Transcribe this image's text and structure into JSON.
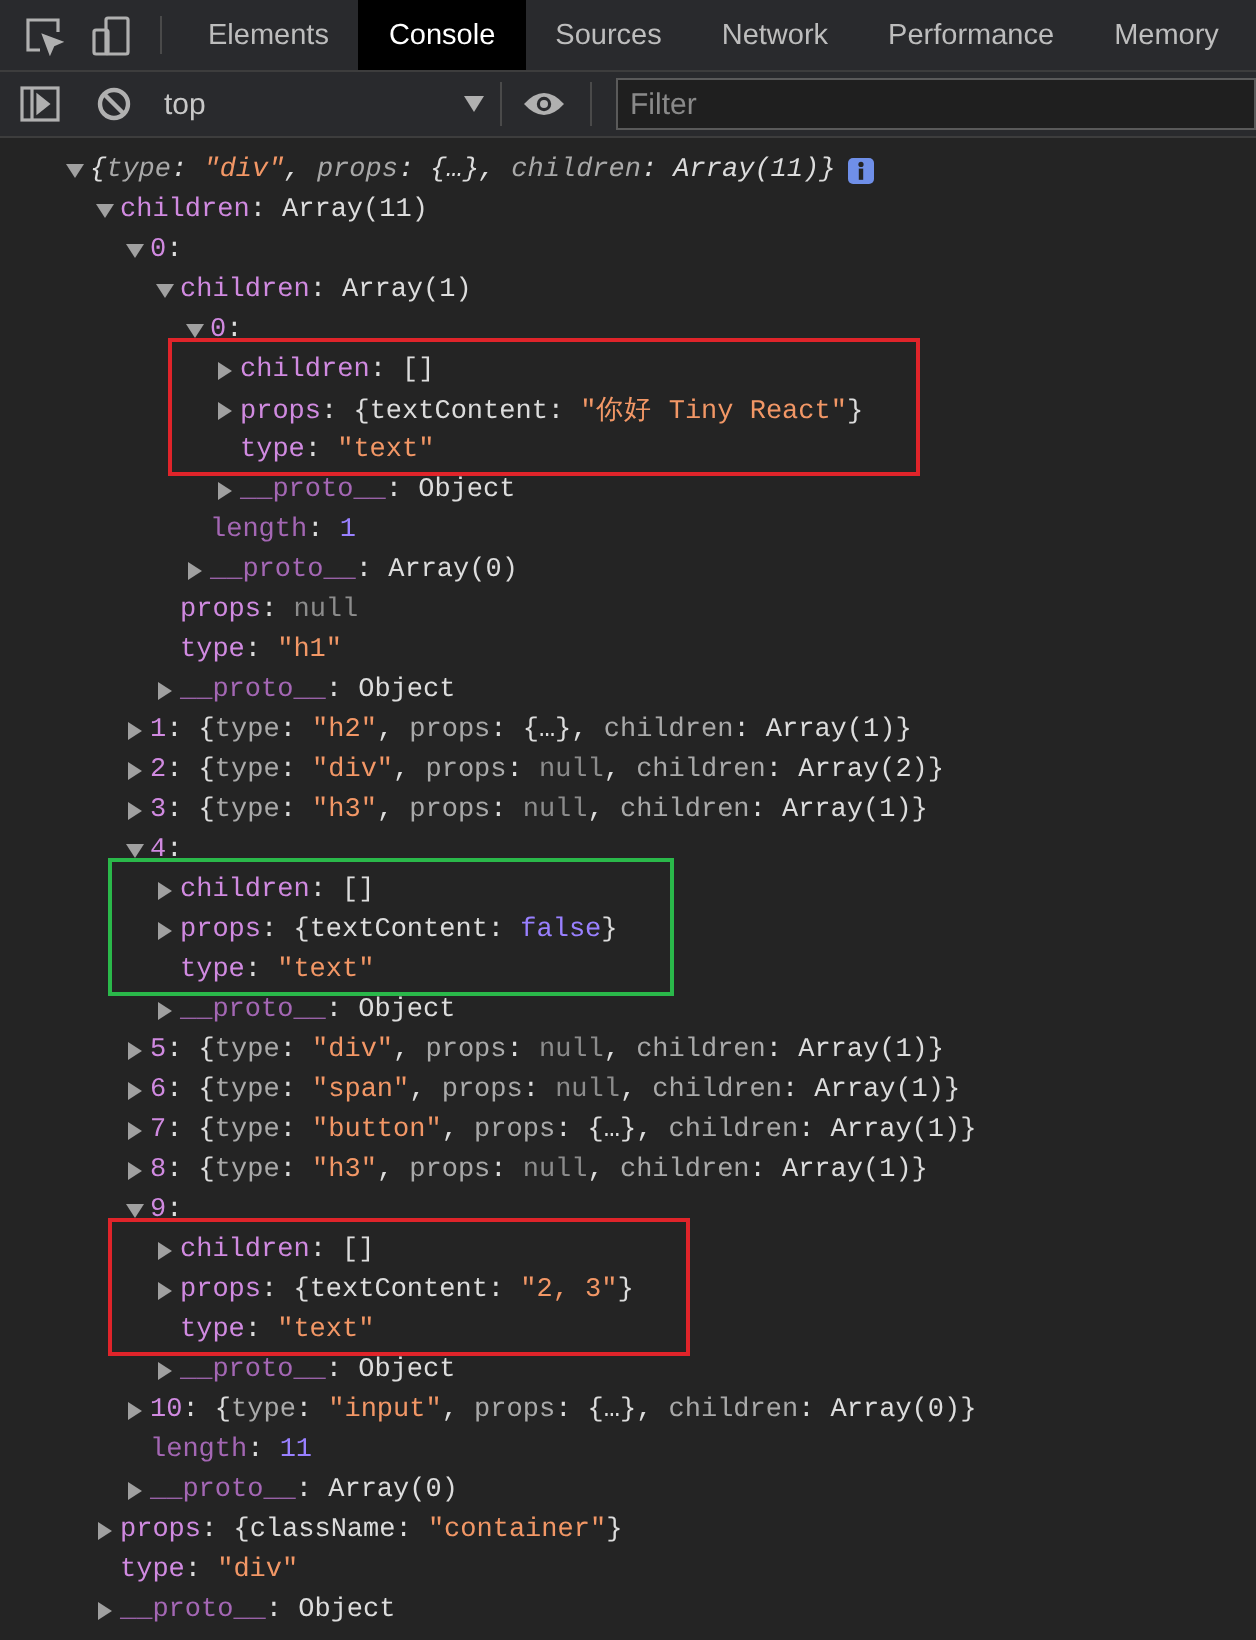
{
  "toolbar": {
    "tabs": [
      {
        "label": "Elements",
        "selected": false
      },
      {
        "label": "Console",
        "selected": true
      },
      {
        "label": "Sources",
        "selected": false
      },
      {
        "label": "Network",
        "selected": false
      },
      {
        "label": "Performance",
        "selected": false
      },
      {
        "label": "Memory",
        "selected": false
      }
    ],
    "context": {
      "value": "top"
    },
    "filter": {
      "placeholder": "Filter"
    }
  },
  "tree": [
    {
      "kind": "line",
      "italic": true,
      "badge": true,
      "expanded": true,
      "segments": [
        {
          "kind": "plain",
          "text": "{"
        },
        {
          "kind": "pkey",
          "text": "type"
        },
        {
          "kind": "plain",
          "text": ": "
        },
        {
          "kind": "str",
          "text": "\"div\""
        },
        {
          "kind": "plain",
          "text": ", "
        },
        {
          "kind": "pkey",
          "text": "props"
        },
        {
          "kind": "plain",
          "text": ": {…}, "
        },
        {
          "kind": "pkey",
          "text": "children"
        },
        {
          "kind": "plain",
          "text": ": Array(11)}"
        }
      ],
      "children": [
        {
          "kind": "line",
          "expanded": true,
          "segments": [
            {
              "kind": "key",
              "text": "children"
            },
            {
              "kind": "plain",
              "text": ": Array(11)"
            }
          ],
          "children": [
            {
              "kind": "line",
              "expanded": true,
              "segments": [
                {
                  "kind": "key",
                  "text": "0"
                },
                {
                  "kind": "plain",
                  "text": ":"
                }
              ],
              "children": [
                {
                  "kind": "line",
                  "expanded": true,
                  "segments": [
                    {
                      "kind": "key",
                      "text": "children"
                    },
                    {
                      "kind": "plain",
                      "text": ": Array(1)"
                    }
                  ],
                  "children": [
                    {
                      "kind": "line",
                      "expanded": true,
                      "segments": [
                        {
                          "kind": "key",
                          "text": "0"
                        },
                        {
                          "kind": "plain",
                          "text": ":"
                        }
                      ],
                      "children": [
                        {
                          "kind": "highlight",
                          "color": "#e0242a",
                          "children": [
                            {
                              "kind": "line",
                              "expanded": false,
                              "segments": [
                                {
                                  "kind": "key",
                                  "text": "children"
                                },
                                {
                                  "kind": "plain",
                                  "text": ": []"
                                }
                              ]
                            },
                            {
                              "kind": "line",
                              "expanded": false,
                              "segments": [
                                {
                                  "kind": "key",
                                  "text": "props"
                                },
                                {
                                  "kind": "plain",
                                  "text": ": {textContent: "
                                },
                                {
                                  "kind": "str",
                                  "text": "\"你好 Tiny React\""
                                },
                                {
                                  "kind": "plain",
                                  "text": "}"
                                }
                              ]
                            },
                            {
                              "kind": "line",
                              "segments": [
                                {
                                  "kind": "key",
                                  "text": "type"
                                },
                                {
                                  "kind": "plain",
                                  "text": ": "
                                },
                                {
                                  "kind": "str",
                                  "text": "\"text\""
                                }
                              ]
                            }
                          ]
                        },
                        {
                          "kind": "line",
                          "expanded": false,
                          "segments": [
                            {
                              "kind": "meta",
                              "text": "__proto__"
                            },
                            {
                              "kind": "plain",
                              "text": ": Object"
                            }
                          ]
                        }
                      ]
                    },
                    {
                      "kind": "line",
                      "segments": [
                        {
                          "kind": "meta",
                          "text": "length"
                        },
                        {
                          "kind": "plain",
                          "text": ": "
                        },
                        {
                          "kind": "num",
                          "text": "1"
                        }
                      ]
                    },
                    {
                      "kind": "line",
                      "expanded": false,
                      "segments": [
                        {
                          "kind": "meta",
                          "text": "__proto__"
                        },
                        {
                          "kind": "plain",
                          "text": ": Array(0)"
                        }
                      ]
                    }
                  ]
                },
                {
                  "kind": "line",
                  "segments": [
                    {
                      "kind": "key",
                      "text": "props"
                    },
                    {
                      "kind": "plain",
                      "text": ": "
                    },
                    {
                      "kind": "null",
                      "text": "null"
                    }
                  ]
                },
                {
                  "kind": "line",
                  "segments": [
                    {
                      "kind": "key",
                      "text": "type"
                    },
                    {
                      "kind": "plain",
                      "text": ": "
                    },
                    {
                      "kind": "str",
                      "text": "\"h1\""
                    }
                  ]
                },
                {
                  "kind": "line",
                  "expanded": false,
                  "segments": [
                    {
                      "kind": "meta",
                      "text": "__proto__"
                    },
                    {
                      "kind": "plain",
                      "text": ": Object"
                    }
                  ]
                }
              ]
            },
            {
              "kind": "line",
              "expanded": false,
              "segments": [
                {
                  "kind": "key",
                  "text": "1"
                },
                {
                  "kind": "plain",
                  "text": ": {"
                },
                {
                  "kind": "pkey",
                  "text": "type"
                },
                {
                  "kind": "plain",
                  "text": ": "
                },
                {
                  "kind": "str",
                  "text": "\"h2\""
                },
                {
                  "kind": "plain",
                  "text": ", "
                },
                {
                  "kind": "pkey",
                  "text": "props"
                },
                {
                  "kind": "plain",
                  "text": ": {…}, "
                },
                {
                  "kind": "pkey",
                  "text": "children"
                },
                {
                  "kind": "plain",
                  "text": ": Array(1)}"
                }
              ]
            },
            {
              "kind": "line",
              "expanded": false,
              "segments": [
                {
                  "kind": "key",
                  "text": "2"
                },
                {
                  "kind": "plain",
                  "text": ": {"
                },
                {
                  "kind": "pkey",
                  "text": "type"
                },
                {
                  "kind": "plain",
                  "text": ": "
                },
                {
                  "kind": "str",
                  "text": "\"div\""
                },
                {
                  "kind": "plain",
                  "text": ", "
                },
                {
                  "kind": "pkey",
                  "text": "props"
                },
                {
                  "kind": "plain",
                  "text": ": "
                },
                {
                  "kind": "null",
                  "text": "null"
                },
                {
                  "kind": "plain",
                  "text": ", "
                },
                {
                  "kind": "pkey",
                  "text": "children"
                },
                {
                  "kind": "plain",
                  "text": ": Array(2)}"
                }
              ]
            },
            {
              "kind": "line",
              "expanded": false,
              "segments": [
                {
                  "kind": "key",
                  "text": "3"
                },
                {
                  "kind": "plain",
                  "text": ": {"
                },
                {
                  "kind": "pkey",
                  "text": "type"
                },
                {
                  "kind": "plain",
                  "text": ": "
                },
                {
                  "kind": "str",
                  "text": "\"h3\""
                },
                {
                  "kind": "plain",
                  "text": ", "
                },
                {
                  "kind": "pkey",
                  "text": "props"
                },
                {
                  "kind": "plain",
                  "text": ": "
                },
                {
                  "kind": "null",
                  "text": "null"
                },
                {
                  "kind": "plain",
                  "text": ", "
                },
                {
                  "kind": "pkey",
                  "text": "children"
                },
                {
                  "kind": "plain",
                  "text": ": Array(1)}"
                }
              ]
            },
            {
              "kind": "line",
              "expanded": true,
              "segments": [
                {
                  "kind": "key",
                  "text": "4"
                },
                {
                  "kind": "plain",
                  "text": ":"
                }
              ],
              "children": [
                {
                  "kind": "highlight",
                  "color": "#2ab84a",
                  "children": [
                    {
                      "kind": "line",
                      "expanded": false,
                      "segments": [
                        {
                          "kind": "key",
                          "text": "children"
                        },
                        {
                          "kind": "plain",
                          "text": ": []"
                        }
                      ]
                    },
                    {
                      "kind": "line",
                      "expanded": false,
                      "segments": [
                        {
                          "kind": "key",
                          "text": "props"
                        },
                        {
                          "kind": "plain",
                          "text": ": {textContent: "
                        },
                        {
                          "kind": "num",
                          "text": "false"
                        },
                        {
                          "kind": "plain",
                          "text": "}"
                        }
                      ]
                    },
                    {
                      "kind": "line",
                      "segments": [
                        {
                          "kind": "key",
                          "text": "type"
                        },
                        {
                          "kind": "plain",
                          "text": ": "
                        },
                        {
                          "kind": "str",
                          "text": "\"text\""
                        }
                      ]
                    }
                  ]
                },
                {
                  "kind": "line",
                  "expanded": false,
                  "segments": [
                    {
                      "kind": "meta",
                      "text": "__proto__"
                    },
                    {
                      "kind": "plain",
                      "text": ": Object"
                    }
                  ]
                }
              ]
            },
            {
              "kind": "line",
              "expanded": false,
              "segments": [
                {
                  "kind": "key",
                  "text": "5"
                },
                {
                  "kind": "plain",
                  "text": ": {"
                },
                {
                  "kind": "pkey",
                  "text": "type"
                },
                {
                  "kind": "plain",
                  "text": ": "
                },
                {
                  "kind": "str",
                  "text": "\"div\""
                },
                {
                  "kind": "plain",
                  "text": ", "
                },
                {
                  "kind": "pkey",
                  "text": "props"
                },
                {
                  "kind": "plain",
                  "text": ": "
                },
                {
                  "kind": "null",
                  "text": "null"
                },
                {
                  "kind": "plain",
                  "text": ", "
                },
                {
                  "kind": "pkey",
                  "text": "children"
                },
                {
                  "kind": "plain",
                  "text": ": Array(1)}"
                }
              ]
            },
            {
              "kind": "line",
              "expanded": false,
              "segments": [
                {
                  "kind": "key",
                  "text": "6"
                },
                {
                  "kind": "plain",
                  "text": ": {"
                },
                {
                  "kind": "pkey",
                  "text": "type"
                },
                {
                  "kind": "plain",
                  "text": ": "
                },
                {
                  "kind": "str",
                  "text": "\"span\""
                },
                {
                  "kind": "plain",
                  "text": ", "
                },
                {
                  "kind": "pkey",
                  "text": "props"
                },
                {
                  "kind": "plain",
                  "text": ": "
                },
                {
                  "kind": "null",
                  "text": "null"
                },
                {
                  "kind": "plain",
                  "text": ", "
                },
                {
                  "kind": "pkey",
                  "text": "children"
                },
                {
                  "kind": "plain",
                  "text": ": Array(1)}"
                }
              ]
            },
            {
              "kind": "line",
              "expanded": false,
              "segments": [
                {
                  "kind": "key",
                  "text": "7"
                },
                {
                  "kind": "plain",
                  "text": ": {"
                },
                {
                  "kind": "pkey",
                  "text": "type"
                },
                {
                  "kind": "plain",
                  "text": ": "
                },
                {
                  "kind": "str",
                  "text": "\"button\""
                },
                {
                  "kind": "plain",
                  "text": ", "
                },
                {
                  "kind": "pkey",
                  "text": "props"
                },
                {
                  "kind": "plain",
                  "text": ": {…}, "
                },
                {
                  "kind": "pkey",
                  "text": "children"
                },
                {
                  "kind": "plain",
                  "text": ": Array(1)}"
                }
              ]
            },
            {
              "kind": "line",
              "expanded": false,
              "segments": [
                {
                  "kind": "key",
                  "text": "8"
                },
                {
                  "kind": "plain",
                  "text": ": {"
                },
                {
                  "kind": "pkey",
                  "text": "type"
                },
                {
                  "kind": "plain",
                  "text": ": "
                },
                {
                  "kind": "str",
                  "text": "\"h3\""
                },
                {
                  "kind": "plain",
                  "text": ", "
                },
                {
                  "kind": "pkey",
                  "text": "props"
                },
                {
                  "kind": "plain",
                  "text": ": "
                },
                {
                  "kind": "null",
                  "text": "null"
                },
                {
                  "kind": "plain",
                  "text": ", "
                },
                {
                  "kind": "pkey",
                  "text": "children"
                },
                {
                  "kind": "plain",
                  "text": ": Array(1)}"
                }
              ]
            },
            {
              "kind": "line",
              "expanded": true,
              "segments": [
                {
                  "kind": "key",
                  "text": "9"
                },
                {
                  "kind": "plain",
                  "text": ":"
                }
              ],
              "children": [
                {
                  "kind": "highlight",
                  "color": "#e0242a",
                  "children": [
                    {
                      "kind": "line",
                      "expanded": false,
                      "segments": [
                        {
                          "kind": "key",
                          "text": "children"
                        },
                        {
                          "kind": "plain",
                          "text": ": []"
                        }
                      ]
                    },
                    {
                      "kind": "line",
                      "expanded": false,
                      "segments": [
                        {
                          "kind": "key",
                          "text": "props"
                        },
                        {
                          "kind": "plain",
                          "text": ": {textContent: "
                        },
                        {
                          "kind": "str",
                          "text": "\"2, 3\""
                        },
                        {
                          "kind": "plain",
                          "text": "}"
                        }
                      ]
                    },
                    {
                      "kind": "line",
                      "segments": [
                        {
                          "kind": "key",
                          "text": "type"
                        },
                        {
                          "kind": "plain",
                          "text": ": "
                        },
                        {
                          "kind": "str",
                          "text": "\"text\""
                        }
                      ]
                    }
                  ]
                },
                {
                  "kind": "line",
                  "expanded": false,
                  "segments": [
                    {
                      "kind": "meta",
                      "text": "__proto__"
                    },
                    {
                      "kind": "plain",
                      "text": ": Object"
                    }
                  ]
                }
              ]
            },
            {
              "kind": "line",
              "expanded": false,
              "segments": [
                {
                  "kind": "key",
                  "text": "10"
                },
                {
                  "kind": "plain",
                  "text": ": {"
                },
                {
                  "kind": "pkey",
                  "text": "type"
                },
                {
                  "kind": "plain",
                  "text": ": "
                },
                {
                  "kind": "str",
                  "text": "\"input\""
                },
                {
                  "kind": "plain",
                  "text": ", "
                },
                {
                  "kind": "pkey",
                  "text": "props"
                },
                {
                  "kind": "plain",
                  "text": ": {…}, "
                },
                {
                  "kind": "pkey",
                  "text": "children"
                },
                {
                  "kind": "plain",
                  "text": ": Array(0)}"
                }
              ]
            },
            {
              "kind": "line",
              "segments": [
                {
                  "kind": "meta",
                  "text": "length"
                },
                {
                  "kind": "plain",
                  "text": ": "
                },
                {
                  "kind": "num",
                  "text": "11"
                }
              ]
            },
            {
              "kind": "line",
              "expanded": false,
              "segments": [
                {
                  "kind": "meta",
                  "text": "__proto__"
                },
                {
                  "kind": "plain",
                  "text": ": Array(0)"
                }
              ]
            }
          ]
        },
        {
          "kind": "line",
          "expanded": false,
          "segments": [
            {
              "kind": "key",
              "text": "props"
            },
            {
              "kind": "plain",
              "text": ": {className: "
            },
            {
              "kind": "str",
              "text": "\"container\""
            },
            {
              "kind": "plain",
              "text": "}"
            }
          ]
        },
        {
          "kind": "line",
          "segments": [
            {
              "kind": "key",
              "text": "type"
            },
            {
              "kind": "plain",
              "text": ": "
            },
            {
              "kind": "str",
              "text": "\"div\""
            }
          ]
        },
        {
          "kind": "line",
          "expanded": false,
          "segments": [
            {
              "kind": "meta",
              "text": "__proto__"
            },
            {
              "kind": "plain",
              "text": ": Object"
            }
          ]
        }
      ]
    }
  ]
}
